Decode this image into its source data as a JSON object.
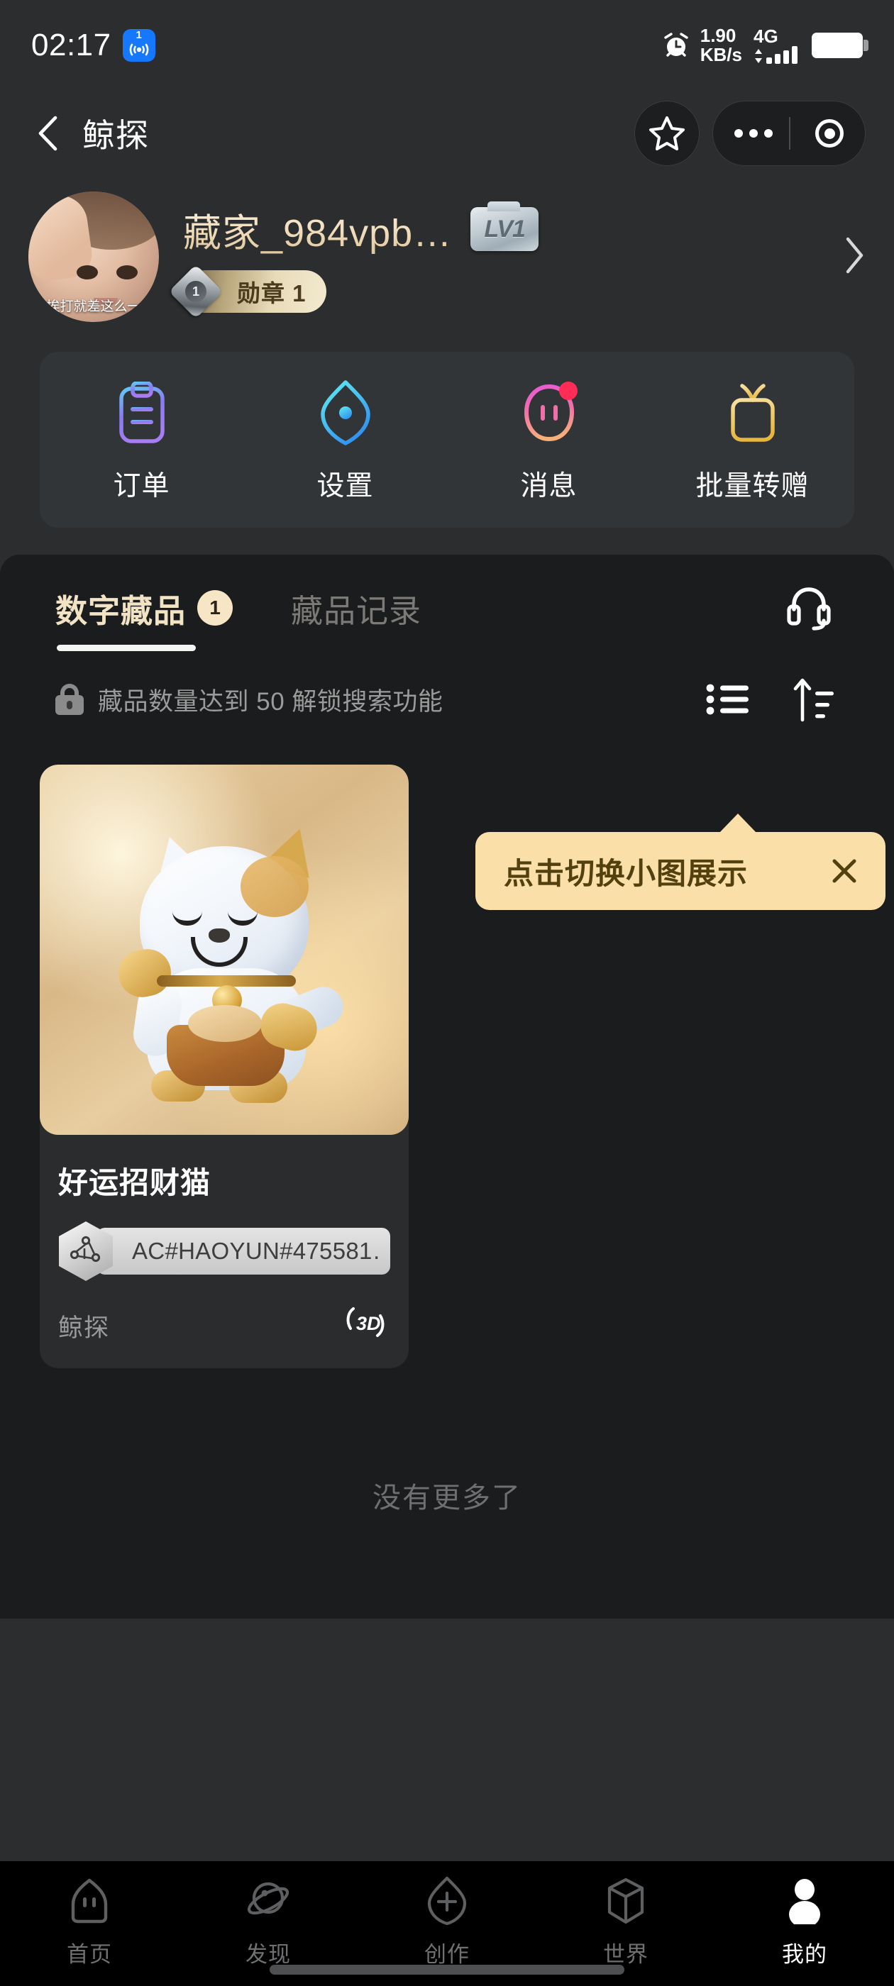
{
  "status_bar": {
    "time": "02:17",
    "nfc_badge_count": "1",
    "nfc_icon": "broadcast-icon",
    "alarm_icon": "alarm-clock-icon",
    "network_speed_value": "1.90",
    "network_speed_unit": "KB/s",
    "network_type": "4G",
    "signal_icon": "signal-bars-icon",
    "battery_icon": "battery-full-icon"
  },
  "header": {
    "back_icon": "back-chevron-icon",
    "title": "鲸探",
    "favorite_icon": "star-icon",
    "more_icon": "more-dots-icon",
    "close_mini_icon": "target-circle-icon"
  },
  "profile": {
    "avatar_caption": "挨打就差这么一",
    "name": "藏家_984vpb…",
    "level_badge": "LV1",
    "medal_label": "勋章 1",
    "medal_number": "1",
    "chevron_icon": "chevron-right-icon"
  },
  "quick_actions": [
    {
      "label": "订单",
      "icon": "clipboard-icon",
      "badge": false
    },
    {
      "label": "设置",
      "icon": "hexagon-gear-icon",
      "badge": false
    },
    {
      "label": "消息",
      "icon": "message-face-icon",
      "badge": true
    },
    {
      "label": "批量转赠",
      "icon": "gift-box-icon",
      "badge": false
    }
  ],
  "tabs": {
    "items": [
      {
        "label": "数字藏品",
        "count": "1",
        "active": true
      },
      {
        "label": "藏品记录",
        "count": "",
        "active": false
      }
    ],
    "support_icon": "headset-icon"
  },
  "toolbar": {
    "lock_icon": "lock-icon",
    "lock_text": "藏品数量达到 50 解锁搜索功能",
    "list_view_icon": "list-view-icon",
    "sort_icon": "sort-ascending-icon"
  },
  "tooltip": {
    "text": "点击切换小图展示",
    "close_icon": "close-x-icon"
  },
  "collection": {
    "items": [
      {
        "title": "好运招财猫",
        "serial": "AC#HAOYUN#475581…",
        "issuer": "鲸探",
        "chain_icon": "blockchain-hexagon-icon",
        "media_badge": "3D",
        "image_alt": "lucky-cat-figurine"
      }
    ],
    "end_text": "没有更多了"
  },
  "bottom_nav": [
    {
      "label": "首页",
      "icon": "house-icon",
      "active": false
    },
    {
      "label": "发现",
      "icon": "planet-icon",
      "active": false
    },
    {
      "label": "创作",
      "icon": "plus-shield-icon",
      "active": false
    },
    {
      "label": "世界",
      "icon": "cube-icon",
      "active": false
    },
    {
      "label": "我的",
      "icon": "person-icon",
      "active": true
    }
  ],
  "colors": {
    "page_bg": "#2b2d2e",
    "panel_bg": "#1a1c1d",
    "card_bg": "#2a2c2d",
    "accent_cream": "#f2e3c5",
    "tooltip_bg": "#fbdfa9",
    "tooltip_text": "#52400f",
    "badge_red": "#ff2d55",
    "nfc_blue": "#1677ff"
  }
}
